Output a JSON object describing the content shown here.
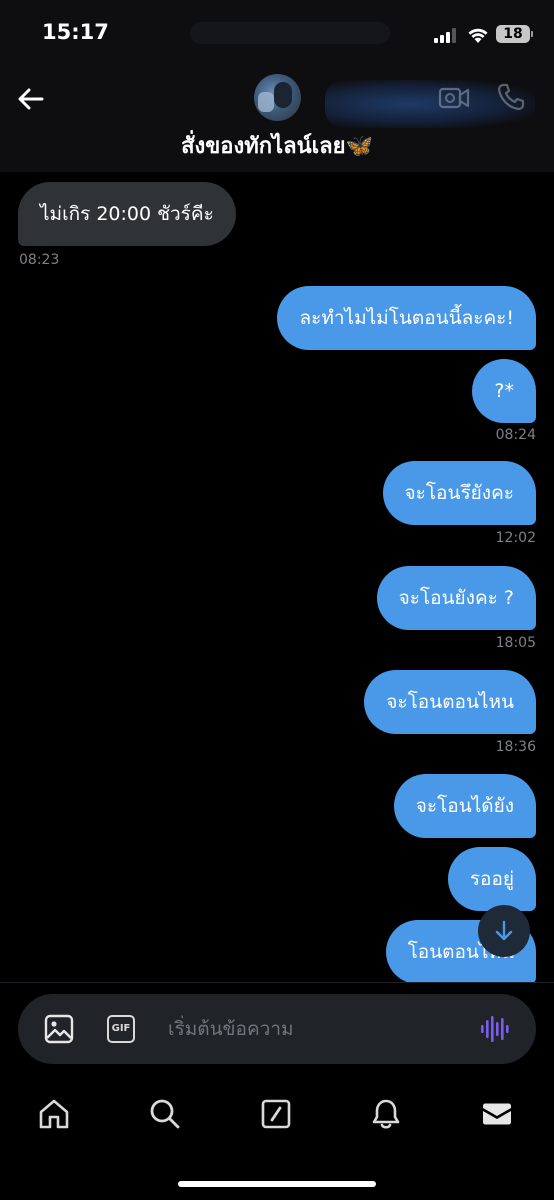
{
  "status_bar": {
    "time": "15:17",
    "battery": "18"
  },
  "header": {
    "back_icon": "arrow-left-icon",
    "title": "สั่งของทักไลน์เลย🦋",
    "video_icon": "video-camera-icon",
    "phone_icon": "phone-icon"
  },
  "messages": [
    {
      "direction": "in",
      "text": "ไม่เกิร 20:00 ชัวร์คีะ",
      "time": "08:23"
    },
    {
      "direction": "out",
      "text": "ละทำไมไม่โนตอนนี้ละคะ!",
      "time": ""
    },
    {
      "direction": "out",
      "text": "?*",
      "time": "08:24"
    },
    {
      "direction": "out",
      "text": "จะโอนรึยังคะ",
      "time": "12:02"
    },
    {
      "direction": "out",
      "text": "จะโอนยังคะ ?",
      "time": "18:05"
    },
    {
      "direction": "out",
      "text": "จะโอนตอนไหน",
      "time": "18:36"
    },
    {
      "direction": "out",
      "text": "จะโอนได้ยัง",
      "time": ""
    },
    {
      "direction": "out",
      "text": "รออยู่",
      "time": ""
    },
    {
      "direction": "out",
      "text": "โอนตอนไหน",
      "time": ""
    }
  ],
  "composer": {
    "placeholder": "เริ่มต้นข้อความ",
    "gif_label": "GIF",
    "image_icon": "image-icon",
    "voice_icon": "voice-waveform-icon"
  },
  "nav": {
    "items": [
      "home-icon",
      "search-icon",
      "compose-icon",
      "bell-icon",
      "envelope-icon"
    ]
  },
  "colors": {
    "outgoing_bubble": "#4a99e9",
    "incoming_bubble": "#2f3336",
    "voice_accent": "#7b5cf0"
  }
}
